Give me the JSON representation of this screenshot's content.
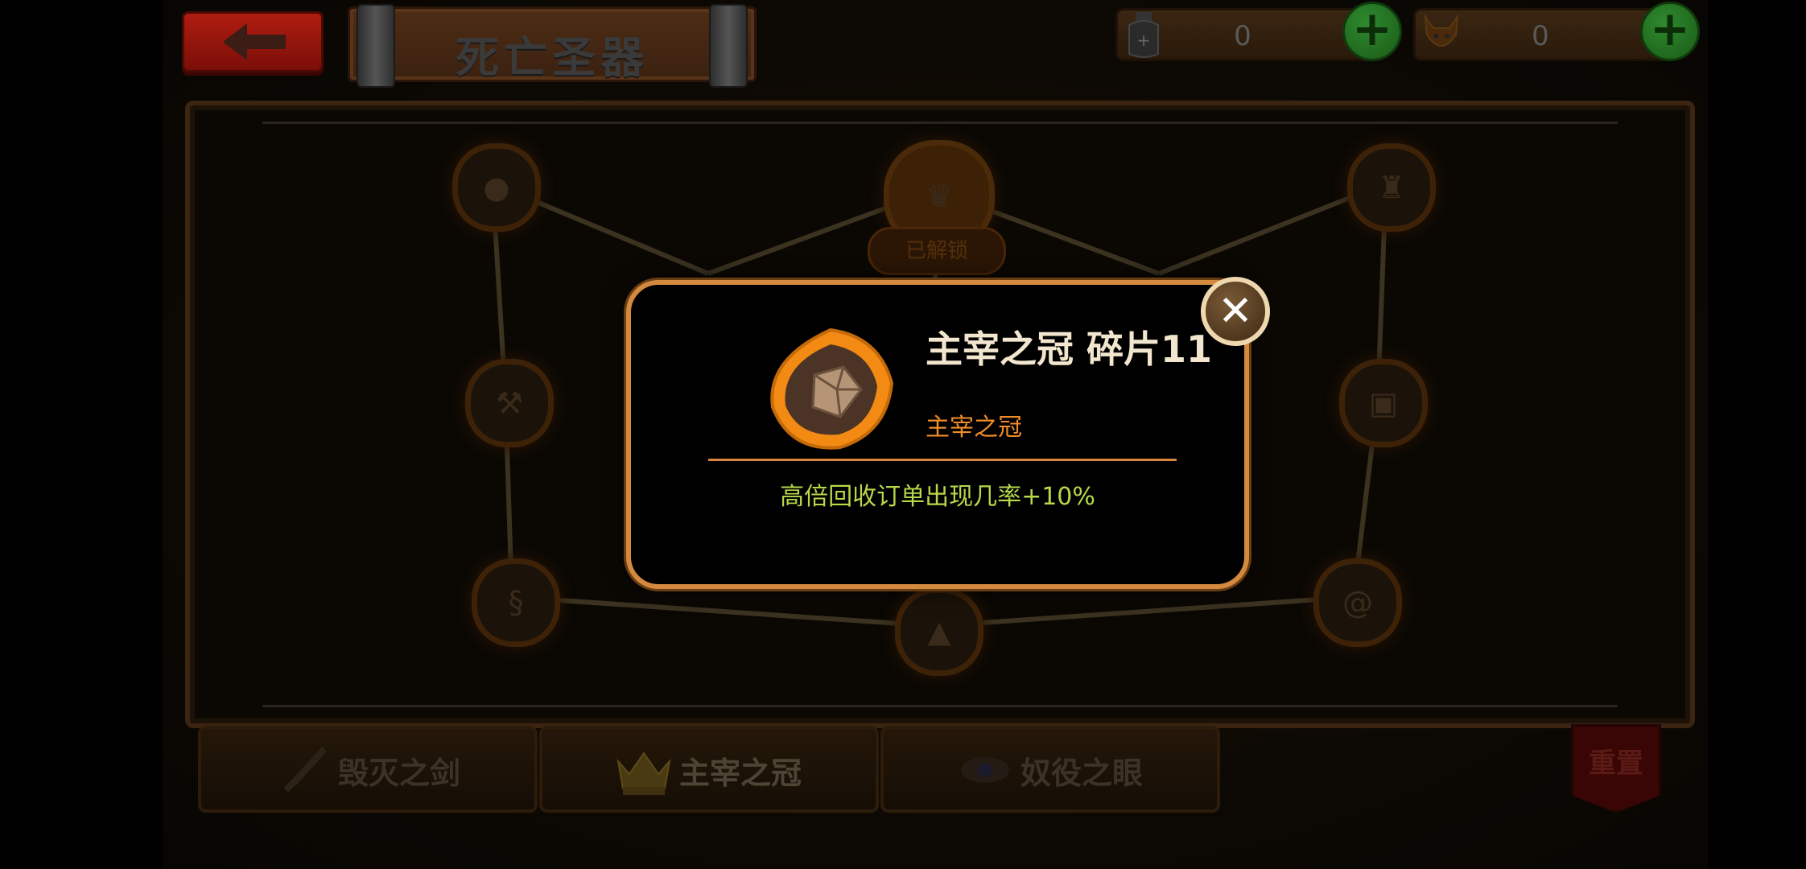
{
  "header": {
    "back_label": "back",
    "title": "死亡圣器",
    "resources": [
      {
        "icon": "bottle-icon",
        "value": "0"
      },
      {
        "icon": "demon-icon",
        "value": "0"
      }
    ]
  },
  "board": {
    "center_node_tag": "已解锁"
  },
  "tabs": [
    {
      "label": "毁灭之剑",
      "icon": "sword-icon",
      "active": false
    },
    {
      "label": "主宰之冠",
      "icon": "crown-icon",
      "active": true
    },
    {
      "label": "奴役之眼",
      "icon": "eye-icon",
      "active": false
    }
  ],
  "reset_label": "重置",
  "popup": {
    "name": "主宰之冠 碎片11",
    "set_name": "主宰之冠",
    "description": "高倍回收订单出现几率+10%",
    "icon": "shard-gem-icon",
    "accent_color": "#f08c2a",
    "desc_color": "#b7d84a"
  }
}
